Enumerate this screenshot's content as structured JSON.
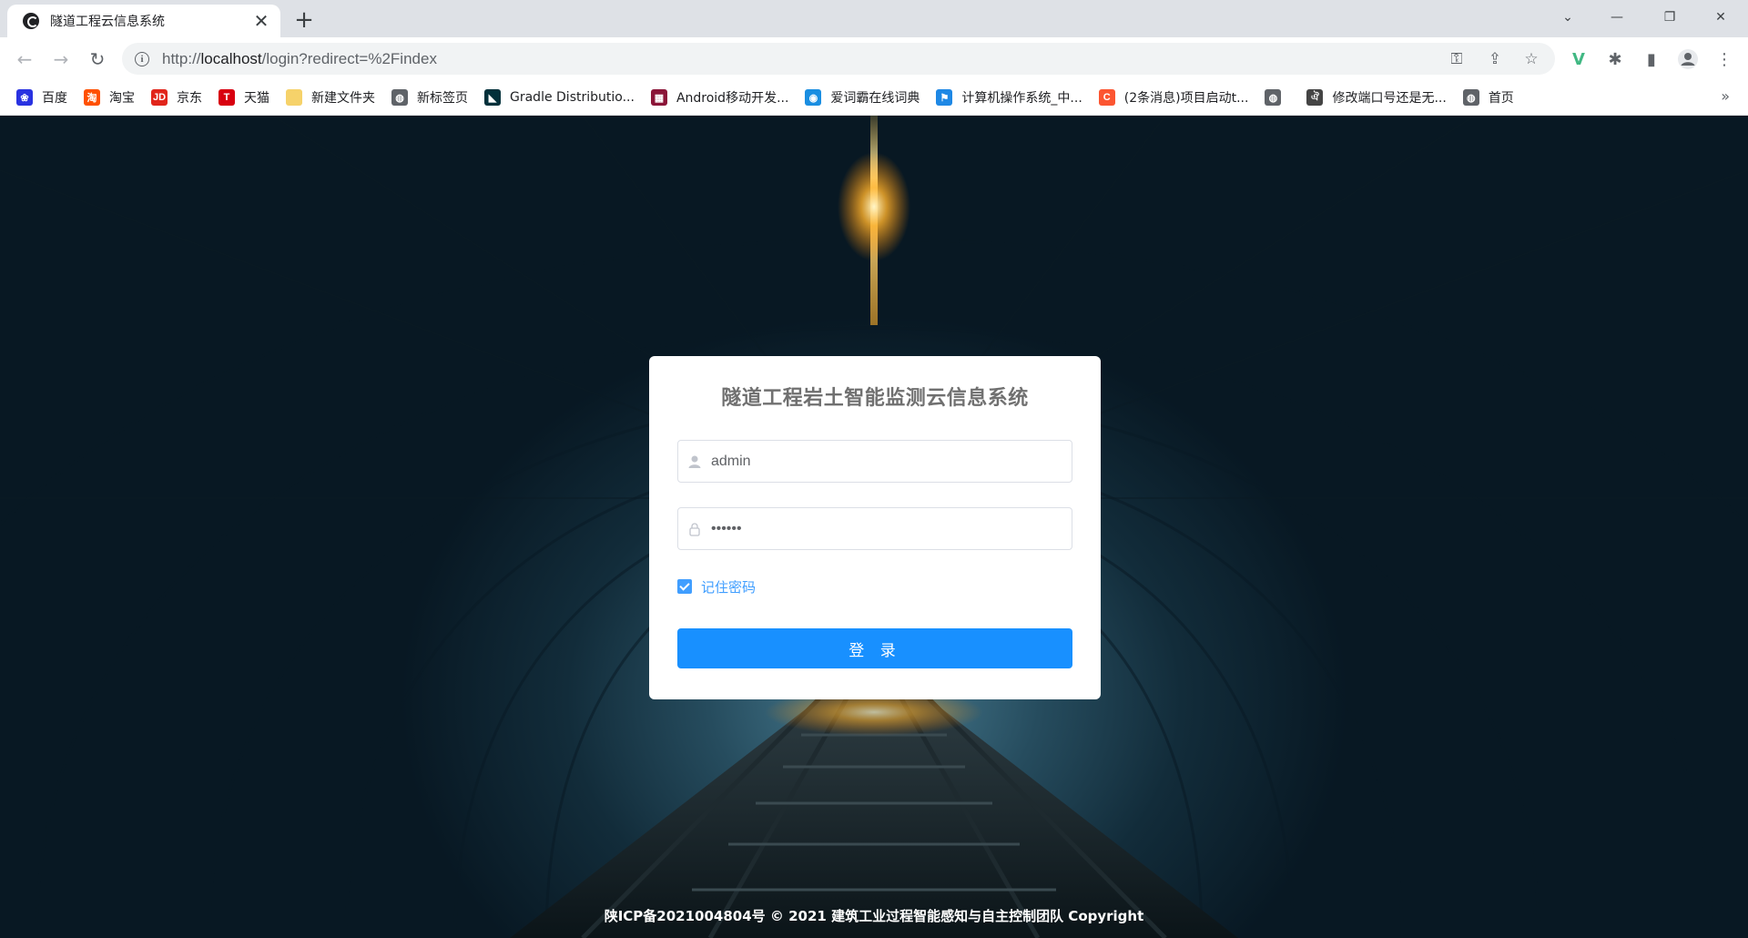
{
  "browser": {
    "tab": {
      "title": "隧道工程云信息系统",
      "favicon": "circle-logo-icon",
      "close": "✕"
    },
    "new_tab": "+",
    "window_controls": {
      "dropdown": "⌄",
      "minimize": "—",
      "restore": "❐",
      "close": "✕"
    },
    "address": {
      "scheme": "http://",
      "host": "localhost",
      "path": "/login?redirect=%2Findex"
    },
    "toolbar_icons": [
      "key-icon",
      "share-icon",
      "star-icon",
      "vue-devtools-icon",
      "extensions-icon",
      "side-panel-icon",
      "profile-icon",
      "menu-icon"
    ]
  },
  "bookmarks": [
    {
      "label": "百度",
      "icon": "baidu-paw-icon",
      "icon_text": "❀",
      "color": "#2932e1"
    },
    {
      "label": "淘宝",
      "icon": "taobao-icon",
      "icon_text": "淘",
      "color": "#ff5000"
    },
    {
      "label": "京东",
      "icon": "jd-icon",
      "icon_text": "JD",
      "color": "#e1251b"
    },
    {
      "label": "天猫",
      "icon": "tmall-icon",
      "icon_text": "T",
      "color": "#d8000f"
    },
    {
      "label": "新建文件夹",
      "icon": "folder-icon",
      "icon_text": "",
      "color": "#f6d26a"
    },
    {
      "label": "新标签页",
      "icon": "globe-icon",
      "icon_text": "◍",
      "color": "#5f6368"
    },
    {
      "label": "Gradle Distributio...",
      "icon": "gradle-icon",
      "icon_text": "◣",
      "color": "#02303a"
    },
    {
      "label": "Android移动开发...",
      "icon": "android-dev-icon",
      "icon_text": "▦",
      "color": "#8b1538"
    },
    {
      "label": "爱词霸在线词典",
      "icon": "iciba-icon",
      "icon_text": "◉",
      "color": "#1a8ee1"
    },
    {
      "label": "计算机操作系统_中...",
      "icon": "flag-icon",
      "icon_text": "⚑",
      "color": "#1e88e5"
    },
    {
      "label": "(2条消息)项目启动t...",
      "icon": "csdn-icon",
      "icon_text": "C",
      "color": "#fc5531"
    },
    {
      "label": "",
      "icon": "globe-icon",
      "icon_text": "◍",
      "color": "#5f6368"
    },
    {
      "label": "修改端口号还是无...",
      "icon": "custom-icon",
      "icon_text": "ঐ",
      "color": "#444444"
    },
    {
      "label": "首页",
      "icon": "globe-icon",
      "icon_text": "◍",
      "color": "#5f6368"
    }
  ],
  "bookmarks_more": "»",
  "login": {
    "title": "隧道工程岩土智能监测云信息系统",
    "username": "admin",
    "password": "••••••",
    "remember_checked": true,
    "remember_label": "记住密码",
    "submit_label": "登 录"
  },
  "footer": "陕ICP备2021004804号 © 2021 建筑工业过程智能感知与自主控制团队 Copyright"
}
